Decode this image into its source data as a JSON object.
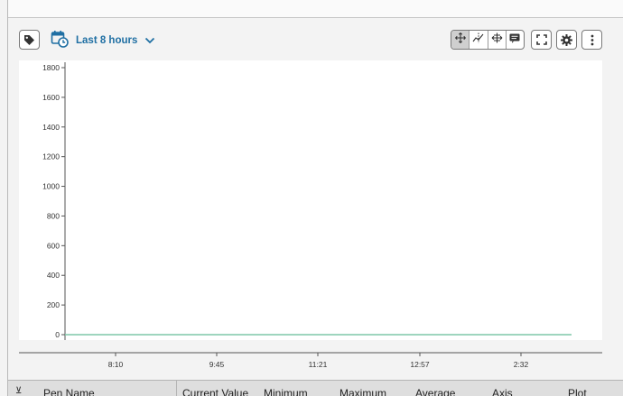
{
  "toolbar": {
    "time_range_label": "Last 8 hours",
    "modes": [
      {
        "icon": "pan-icon",
        "active": true
      },
      {
        "icon": "x-trace-icon",
        "active": false
      },
      {
        "icon": "range-zoom-icon",
        "active": false
      },
      {
        "icon": "annotation-icon",
        "active": false
      }
    ]
  },
  "chart_data": {
    "type": "line",
    "y_ticks": [
      "1800",
      "1600",
      "1400",
      "1200",
      "1000",
      "800",
      "600",
      "400",
      "200",
      "0"
    ],
    "ylim": [
      0,
      1800
    ],
    "x_ticks": [
      "8:10",
      "9:45",
      "11:21",
      "12:57",
      "2:32"
    ],
    "series": [
      {
        "values": [
          0,
          0,
          0,
          0,
          0,
          0
        ],
        "color": "#7fc7a9"
      }
    ],
    "grid": false
  },
  "table": {
    "columns": [
      "Pen Name",
      "Current Value",
      "Minimum",
      "Maximum",
      "Average",
      "Axis",
      "Plot"
    ]
  }
}
